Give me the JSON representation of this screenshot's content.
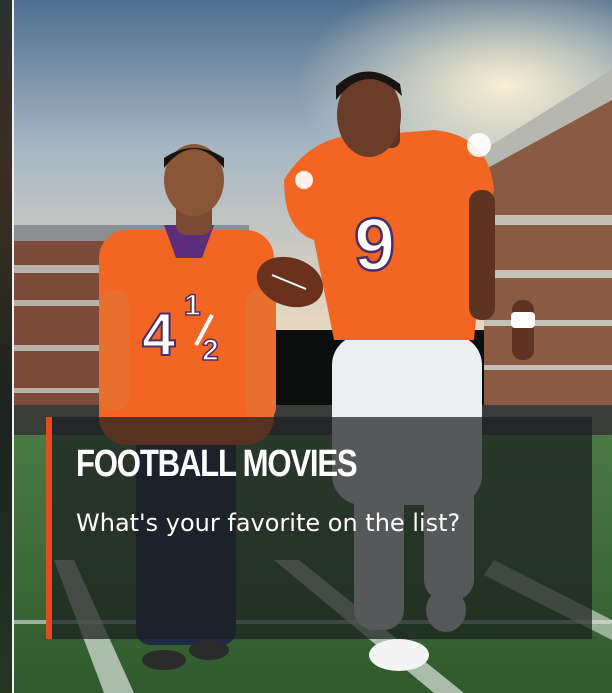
{
  "card": {
    "category": "FOOTBALL MOVIES",
    "headline": "What's your favorite on the list?",
    "image": {
      "kid_jersey_number": "4½",
      "player_jersey_number": "9"
    }
  },
  "colors": {
    "accent": "#e8491d",
    "jersey_orange": "#f26522",
    "field_green": "#3f6b3a",
    "overlay": "#1c1e20"
  }
}
